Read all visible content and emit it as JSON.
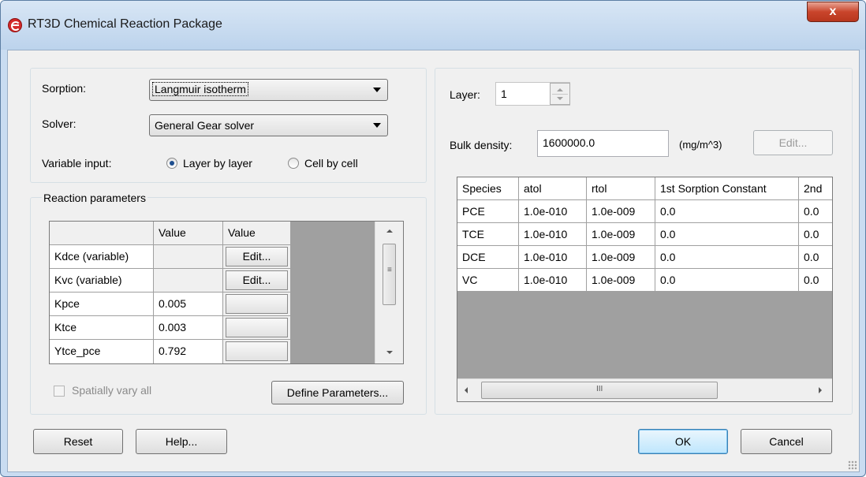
{
  "window": {
    "title": "RT3D Chemical Reaction Package",
    "close_label": "x"
  },
  "sorption": {
    "label": "Sorption:",
    "value": "Langmuir isotherm"
  },
  "solver": {
    "label": "Solver:",
    "value": "General Gear solver"
  },
  "variable_input": {
    "label": "Variable input:",
    "options": [
      "Layer by layer",
      "Cell by cell"
    ],
    "selected": "Layer by layer"
  },
  "reaction_parameters": {
    "title": "Reaction parameters",
    "columns": [
      "",
      "Value",
      "Value"
    ],
    "rows": [
      {
        "name": "Kdce (variable)",
        "value": "",
        "button": "Edit..."
      },
      {
        "name": "Kvc (variable)",
        "value": "",
        "button": "Edit..."
      },
      {
        "name": "Kpce",
        "value": "0.005",
        "button": ""
      },
      {
        "name": "Ktce",
        "value": "0.003",
        "button": ""
      },
      {
        "name": "Ytce_pce",
        "value": "0.792",
        "button": ""
      }
    ],
    "spatially_vary_label": "Spatially vary all",
    "define_button": "Define Parameters..."
  },
  "layer": {
    "label": "Layer:",
    "value": "1"
  },
  "bulk_density": {
    "label": "Bulk density:",
    "value": "1600000.0",
    "unit": "(mg/m^3)",
    "edit_button": "Edit..."
  },
  "species_table": {
    "columns": [
      "Species",
      "atol",
      "rtol",
      "1st Sorption Constant",
      "2nd"
    ],
    "rows": [
      [
        "PCE",
        "1.0e-010",
        "1.0e-009",
        "0.0",
        "0.0"
      ],
      [
        "TCE",
        "1.0e-010",
        "1.0e-009",
        "0.0",
        "0.0"
      ],
      [
        "DCE",
        "1.0e-010",
        "1.0e-009",
        "0.0",
        "0.0"
      ],
      [
        "VC",
        "1.0e-010",
        "1.0e-009",
        "0.0",
        "0.0"
      ]
    ]
  },
  "buttons": {
    "reset": "Reset",
    "help": "Help...",
    "ok": "OK",
    "cancel": "Cancel"
  }
}
